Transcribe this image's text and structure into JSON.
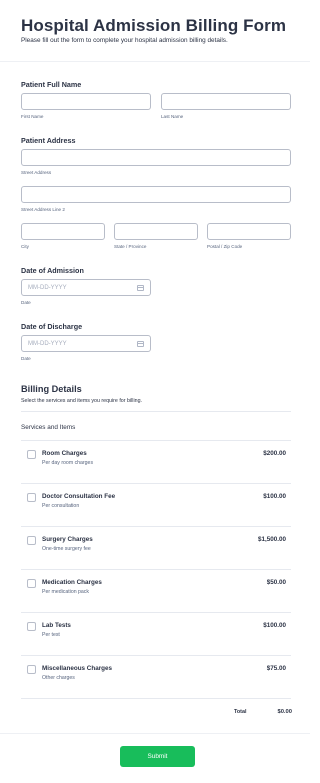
{
  "header": {
    "title": "Hospital Admission Billing Form",
    "subtitle": "Please fill out the form to complete your hospital admission billing details."
  },
  "name": {
    "label": "Patient Full Name",
    "first_sub": "First Name",
    "last_sub": "Last Name"
  },
  "address": {
    "label": "Patient Address",
    "street_sub": "Street Address",
    "street2_sub": "Street Address Line 2",
    "city_sub": "City",
    "state_sub": "State / Province",
    "postal_sub": "Postal / Zip Code"
  },
  "admission": {
    "label": "Date of Admission",
    "placeholder": "MM-DD-YYYY",
    "sub": "Date"
  },
  "discharge": {
    "label": "Date of Discharge",
    "placeholder": "MM-DD-YYYY",
    "sub": "Date"
  },
  "billing": {
    "title": "Billing Details",
    "description": "Select the services and items you require for billing.",
    "services_label": "Services and Items",
    "items": [
      {
        "name": "Room Charges",
        "desc": "Per day room charges",
        "price": "$200.00"
      },
      {
        "name": "Doctor Consultation Fee",
        "desc": "Per consultation",
        "price": "$100.00"
      },
      {
        "name": "Surgery Charges",
        "desc": "One-time surgery fee",
        "price": "$1,500.00"
      },
      {
        "name": "Medication Charges",
        "desc": "Per medication pack",
        "price": "$50.00"
      },
      {
        "name": "Lab Tests",
        "desc": "Per test",
        "price": "$100.00"
      },
      {
        "name": "Miscellaneous Charges",
        "desc": "Other charges",
        "price": "$75.00"
      }
    ],
    "total_label": "Total",
    "total_value": "$0.00"
  },
  "submit_label": "Submit",
  "icons": {
    "date_picker": "calendar-icon"
  },
  "colors": {
    "submit": "#18bd5b",
    "text": "#2c3345",
    "border": "#b8bdc9"
  }
}
